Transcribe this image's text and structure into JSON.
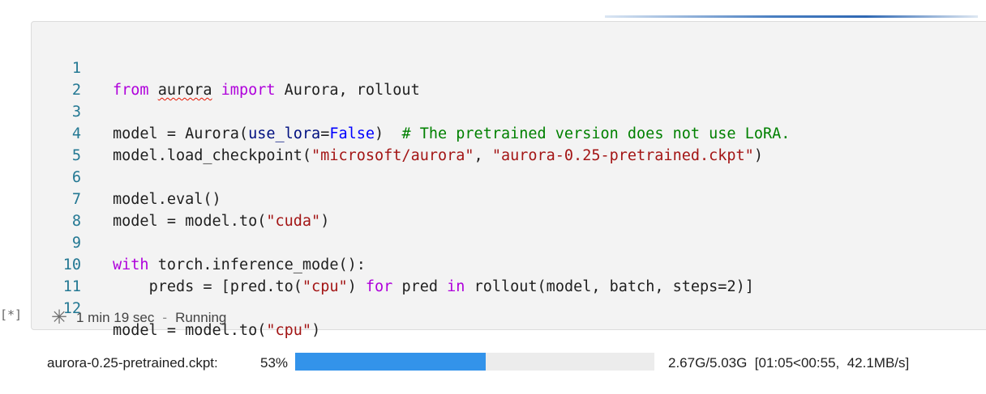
{
  "execution_count": "[*]",
  "status": {
    "icon": "asterisk-spinner-icon",
    "elapsed": "1 min 19 sec",
    "separator": "-",
    "state": "Running"
  },
  "code": {
    "line_numbers": [
      "1",
      "2",
      "3",
      "4",
      "5",
      "6",
      "7",
      "8",
      "9",
      "10",
      "11",
      "12"
    ],
    "l1": {
      "from": "from",
      "module": "aurora",
      "import": "import",
      "rest": " Aurora, rollout"
    },
    "l3": {
      "a": "model = Aurora(",
      "param": "use_lora",
      "eq": "=",
      "false": "False",
      "close": ")  ",
      "comment": "# The pretrained version does not use LoRA."
    },
    "l4": {
      "a": "model.load_checkpoint(",
      "s1": "\"microsoft/aurora\"",
      "comma": ", ",
      "s2": "\"aurora-0.25-pretrained.ckpt\"",
      "close": ")"
    },
    "l6": {
      "a": "model.eval()"
    },
    "l7": {
      "a": "model = model.to(",
      "s": "\"cuda\"",
      "close": ")"
    },
    "l9": {
      "with": "with",
      "b": " torch.inference_mode():"
    },
    "l10": {
      "indent": "    ",
      "a": "preds = [pred.to(",
      "s": "\"cpu\"",
      "close": ") ",
      "for": "for",
      "b": " pred ",
      "in": "in",
      "c": " rollout(model, batch, steps=2)]"
    },
    "l12": {
      "a": "model = model.to(",
      "s": "\"cpu\"",
      "close": ")"
    }
  },
  "download": {
    "filename": "aurora-0.25-pretrained.ckpt:",
    "percent_label": "53%",
    "progress_fraction": 0.53,
    "stats": "2.67G/5.03G  [01:05<00:55,  42.1MB/s]"
  },
  "colors": {
    "progress_fill": "#3393ea",
    "line_number": "#237893",
    "keyword": "#af00db",
    "string": "#a31515",
    "comment": "#008000"
  }
}
